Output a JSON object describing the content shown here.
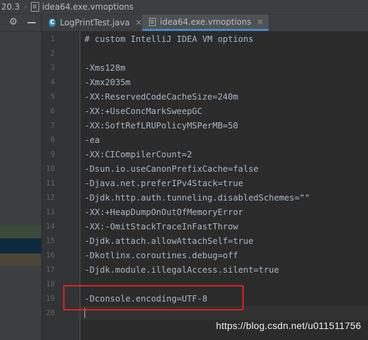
{
  "breadcrumb": {
    "version": "20.3",
    "file": "idea64.exe.vmoptions"
  },
  "tabs": [
    {
      "label": "LogPrintTest.java",
      "icon": "java-class-icon"
    },
    {
      "label": "idea64.exe.vmoptions",
      "icon": "file-icon",
      "active": true
    }
  ],
  "editor": {
    "lines": [
      {
        "num": "1",
        "text": "# custom IntelliJ IDEA VM options"
      },
      {
        "num": "2",
        "text": ""
      },
      {
        "num": "3",
        "text": "-Xms128m"
      },
      {
        "num": "4",
        "text": "-Xmx2035m"
      },
      {
        "num": "5",
        "text": "-XX:ReservedCodeCacheSize=240m"
      },
      {
        "num": "6",
        "text": "-XX:+UseConcMarkSweepGC"
      },
      {
        "num": "7",
        "text": "-XX:SoftRefLRUPolicyMSPerMB=50"
      },
      {
        "num": "8",
        "text": "-ea"
      },
      {
        "num": "9",
        "text": "-XX:CICompilerCount=2"
      },
      {
        "num": "10",
        "text": "-Dsun.io.useCanonPrefixCache=false"
      },
      {
        "num": "11",
        "text": "-Djava.net.preferIPv4Stack=true"
      },
      {
        "num": "12",
        "text": "-Djdk.http.auth.tunneling.disabledSchemes=\"\""
      },
      {
        "num": "13",
        "text": "-XX:+HeapDumpOnOutOfMemoryError"
      },
      {
        "num": "14",
        "text": "-XX:-OmitStackTraceInFastThrow"
      },
      {
        "num": "15",
        "text": "-Djdk.attach.allowAttachSelf=true"
      },
      {
        "num": "16",
        "text": "-Dkotlinx.coroutines.debug=off"
      },
      {
        "num": "17",
        "text": "-Djdk.module.illegalAccess.silent=true"
      },
      {
        "num": "18",
        "text": ""
      },
      {
        "num": "19",
        "text": "-Dconsole.encoding=UTF-8"
      },
      {
        "num": "20",
        "text": ""
      }
    ]
  },
  "watermark": "https://blog.csdn.net/u011511756",
  "colors": {
    "background": "#2b2b2b",
    "highlight_box": "#e0211f",
    "tab_underline": "#4a88c7"
  }
}
